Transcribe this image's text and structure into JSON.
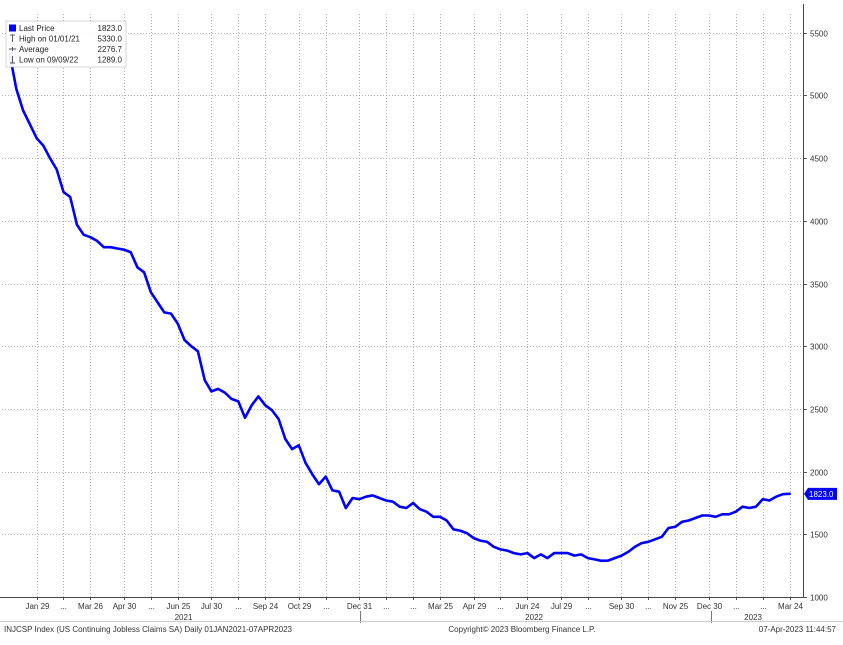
{
  "chart_data": {
    "type": "line",
    "title": "",
    "series": [
      {
        "name": "Last Price",
        "color": "#0000ff",
        "x": [
          "2021-01-01",
          "2021-01-08",
          "2021-01-15",
          "2021-01-22",
          "2021-01-29",
          "2021-02-05",
          "2021-02-12",
          "2021-02-19",
          "2021-02-26",
          "2021-03-05",
          "2021-03-12",
          "2021-03-19",
          "2021-03-26",
          "2021-04-02",
          "2021-04-09",
          "2021-04-16",
          "2021-04-23",
          "2021-04-30",
          "2021-05-07",
          "2021-05-14",
          "2021-05-21",
          "2021-05-28",
          "2021-06-04",
          "2021-06-11",
          "2021-06-18",
          "2021-06-25",
          "2021-07-02",
          "2021-07-09",
          "2021-07-16",
          "2021-07-23",
          "2021-07-30",
          "2021-08-06",
          "2021-08-13",
          "2021-08-20",
          "2021-08-27",
          "2021-09-03",
          "2021-09-10",
          "2021-09-17",
          "2021-09-24",
          "2021-10-01",
          "2021-10-08",
          "2021-10-15",
          "2021-10-22",
          "2021-10-29",
          "2021-11-05",
          "2021-11-12",
          "2021-11-19",
          "2021-11-26",
          "2021-12-03",
          "2021-12-10",
          "2021-12-17",
          "2021-12-24",
          "2021-12-31",
          "2022-01-07",
          "2022-01-14",
          "2022-01-21",
          "2022-01-28",
          "2022-02-04",
          "2022-02-11",
          "2022-02-18",
          "2022-02-25",
          "2022-03-04",
          "2022-03-11",
          "2022-03-18",
          "2022-03-25",
          "2022-04-01",
          "2022-04-08",
          "2022-04-15",
          "2022-04-22",
          "2022-04-29",
          "2022-05-06",
          "2022-05-13",
          "2022-05-20",
          "2022-05-27",
          "2022-06-03",
          "2022-06-10",
          "2022-06-17",
          "2022-06-24",
          "2022-07-01",
          "2022-07-08",
          "2022-07-15",
          "2022-07-22",
          "2022-07-29",
          "2022-08-05",
          "2022-08-12",
          "2022-08-19",
          "2022-08-26",
          "2022-09-02",
          "2022-09-09",
          "2022-09-16",
          "2022-09-23",
          "2022-09-30",
          "2022-10-07",
          "2022-10-14",
          "2022-10-21",
          "2022-10-28",
          "2022-11-04",
          "2022-11-11",
          "2022-11-18",
          "2022-11-25",
          "2022-12-02",
          "2022-12-09",
          "2022-12-16",
          "2022-12-23",
          "2022-12-30",
          "2023-01-06",
          "2023-01-13",
          "2023-01-20",
          "2023-01-27",
          "2023-02-03",
          "2023-02-10",
          "2023-02-17",
          "2023-02-24",
          "2023-03-03",
          "2023-03-10",
          "2023-03-17",
          "2023-03-24"
        ],
        "values": [
          5330,
          5050,
          4880,
          4770,
          4660,
          4600,
          4500,
          4410,
          4230,
          4190,
          3970,
          3890,
          3870,
          3840,
          3790,
          3790,
          3780,
          3770,
          3750,
          3630,
          3590,
          3430,
          3350,
          3270,
          3260,
          3180,
          3050,
          3000,
          2960,
          2730,
          2640,
          2660,
          2630,
          2580,
          2560,
          2430,
          2530,
          2600,
          2530,
          2490,
          2420,
          2260,
          2180,
          2210,
          2070,
          1980,
          1900,
          1960,
          1850,
          1840,
          1710,
          1790,
          1780,
          1800,
          1810,
          1790,
          1770,
          1760,
          1720,
          1710,
          1750,
          1700,
          1680,
          1640,
          1640,
          1610,
          1540,
          1530,
          1510,
          1470,
          1450,
          1440,
          1400,
          1380,
          1370,
          1350,
          1340,
          1350,
          1310,
          1340,
          1310,
          1350,
          1350,
          1350,
          1330,
          1340,
          1310,
          1300,
          1289,
          1290,
          1310,
          1330,
          1360,
          1400,
          1430,
          1440,
          1460,
          1480,
          1550,
          1560,
          1600,
          1610,
          1630,
          1650,
          1650,
          1640,
          1660,
          1660,
          1680,
          1720,
          1710,
          1720,
          1780,
          1770,
          1800,
          1820,
          1823
        ]
      }
    ],
    "ylim": [
      1000,
      5650
    ],
    "yticks": [
      1000,
      1500,
      2000,
      2500,
      3000,
      3500,
      4000,
      4500,
      5000,
      5500
    ],
    "ytick_labels": [
      "1000",
      "1500",
      "2000",
      "2500",
      "3000",
      "3500",
      "4000",
      "4500",
      "5000",
      "5500"
    ],
    "xlim": [
      "2020-12-24",
      "2023-04-07"
    ],
    "xticks": [
      {
        "date": "2021-01-29",
        "label": "Jan 29"
      },
      {
        "date": "2021-02-26",
        "label": "..."
      },
      {
        "date": "2021-03-26",
        "label": "Mar 26"
      },
      {
        "date": "2021-04-30",
        "label": "Apr 30"
      },
      {
        "date": "2021-05-28",
        "label": "..."
      },
      {
        "date": "2021-06-25",
        "label": "Jun 25"
      },
      {
        "date": "2021-07-30",
        "label": "Jul 30"
      },
      {
        "date": "2021-08-27",
        "label": "..."
      },
      {
        "date": "2021-09-24",
        "label": "Sep 24"
      },
      {
        "date": "2021-10-29",
        "label": "Oct 29"
      },
      {
        "date": "2021-11-26",
        "label": "..."
      },
      {
        "date": "2021-12-31",
        "label": "Dec 31"
      },
      {
        "date": "2022-01-28",
        "label": "..."
      },
      {
        "date": "2022-02-25",
        "label": "..."
      },
      {
        "date": "2022-03-25",
        "label": "Mar 25"
      },
      {
        "date": "2022-04-29",
        "label": "Apr 29"
      },
      {
        "date": "2022-05-27",
        "label": "..."
      },
      {
        "date": "2022-06-24",
        "label": "Jun 24"
      },
      {
        "date": "2022-07-29",
        "label": "Jul 29"
      },
      {
        "date": "2022-08-26",
        "label": "..."
      },
      {
        "date": "2022-09-30",
        "label": "Sep 30"
      },
      {
        "date": "2022-10-28",
        "label": "..."
      },
      {
        "date": "2022-11-25",
        "label": "Nov 25"
      },
      {
        "date": "2022-12-30",
        "label": "Dec 30"
      },
      {
        "date": "2023-01-27",
        "label": "..."
      },
      {
        "date": "2023-02-24",
        "label": "..."
      },
      {
        "date": "2023-03-24",
        "label": "Mar 24"
      }
    ],
    "year_labels": [
      {
        "date": "2021-07-01",
        "label": "2021"
      },
      {
        "date": "2022-07-01",
        "label": "2022"
      },
      {
        "date": "2023-02-14",
        "label": "2023"
      }
    ],
    "year_boundaries": [
      "2022-01-01",
      "2023-01-01"
    ],
    "grid": true,
    "legend_position": "top-left",
    "legend": [
      {
        "symbol": "square",
        "label": "Last Price",
        "value": "1823.0"
      },
      {
        "symbol": "high",
        "label": "High on 01/01/21",
        "value": "5330.0"
      },
      {
        "symbol": "average",
        "label": "Average",
        "value": "2276.7"
      },
      {
        "symbol": "low",
        "label": "Low on 09/09/22",
        "value": "1289.0"
      }
    ],
    "last_value_label": "1823.0",
    "accent_color": "#0000ff"
  },
  "footer": {
    "left": "INJCSP Index (US Continuing Jobless Claims SA)  Daily 01JAN2021-07APR2023",
    "center": "Copyright© 2023 Bloomberg Finance L.P.",
    "right": "07-Apr-2023 11:44:57"
  }
}
